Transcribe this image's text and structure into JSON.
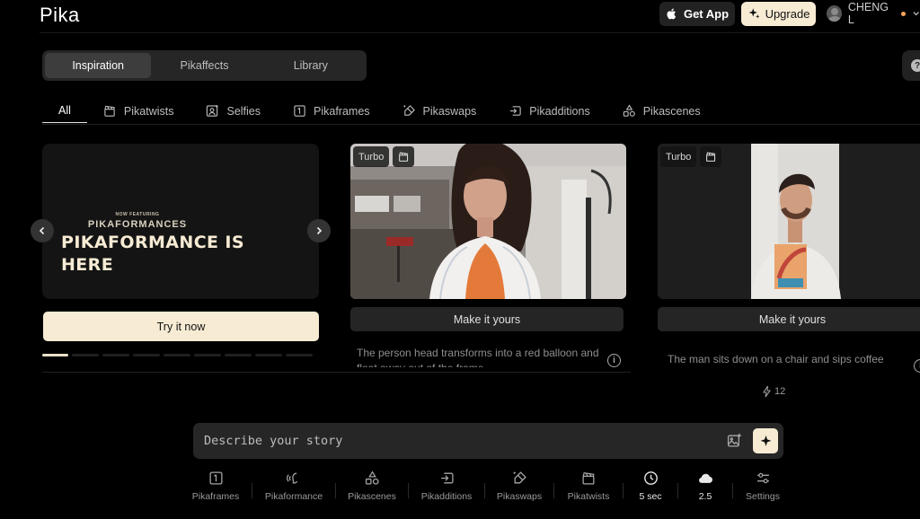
{
  "header": {
    "logo": "Pika",
    "get_app": "Get App",
    "upgrade": "Upgrade",
    "user_name": "CHENG L",
    "help_label": "?"
  },
  "segments": [
    {
      "label": "Inspiration",
      "active": true
    },
    {
      "label": "Pikaffects",
      "active": false
    },
    {
      "label": "Library",
      "active": false
    }
  ],
  "categories": [
    {
      "label": "All",
      "icon": "none"
    },
    {
      "label": "Pikatwists",
      "icon": "clapper-icon"
    },
    {
      "label": "Selfies",
      "icon": "selfie-icon"
    },
    {
      "label": "Pikaframes",
      "icon": "frames-icon"
    },
    {
      "label": "Pikaswaps",
      "icon": "swap-brush-icon"
    },
    {
      "label": "Pikadditions",
      "icon": "addition-icon"
    },
    {
      "label": "Pikascenes",
      "icon": "shapes-icon"
    }
  ],
  "hero": {
    "kicker": "NOW FEATURING",
    "brand": "PIKAFORMANCES",
    "title_line1": "PIKAFORMANCE IS",
    "title_line2": "HERE",
    "cta": "Try it now",
    "pages_total": 9,
    "page_active": 1
  },
  "cards": [
    {
      "badge": "Turbo",
      "action": "Make it yours",
      "description": "The person head transforms into a red balloon and float away out of the frame",
      "info_label": "i"
    },
    {
      "badge": "Turbo",
      "action": "Make it yours",
      "description": "The man sits down on a chair and sips coffee",
      "info_label": "i",
      "likes": "12"
    }
  ],
  "prompt": {
    "placeholder": "Describe your story"
  },
  "toolbar": [
    {
      "label": "Pikaframes",
      "icon": "frames-icon"
    },
    {
      "label": "Pikaformance",
      "icon": "voice-icon"
    },
    {
      "label": "Pikascenes",
      "icon": "shapes-icon"
    },
    {
      "label": "Pikadditions",
      "icon": "addition-icon"
    },
    {
      "label": "Pikaswaps",
      "icon": "swap-brush-icon"
    },
    {
      "label": "Pikatwists",
      "icon": "clapper-icon"
    },
    {
      "label": "5 sec",
      "icon": "clock-icon"
    },
    {
      "label": "2.5",
      "icon": "cloud-model-icon"
    },
    {
      "label": "Settings",
      "icon": "sliders-icon"
    }
  ]
}
